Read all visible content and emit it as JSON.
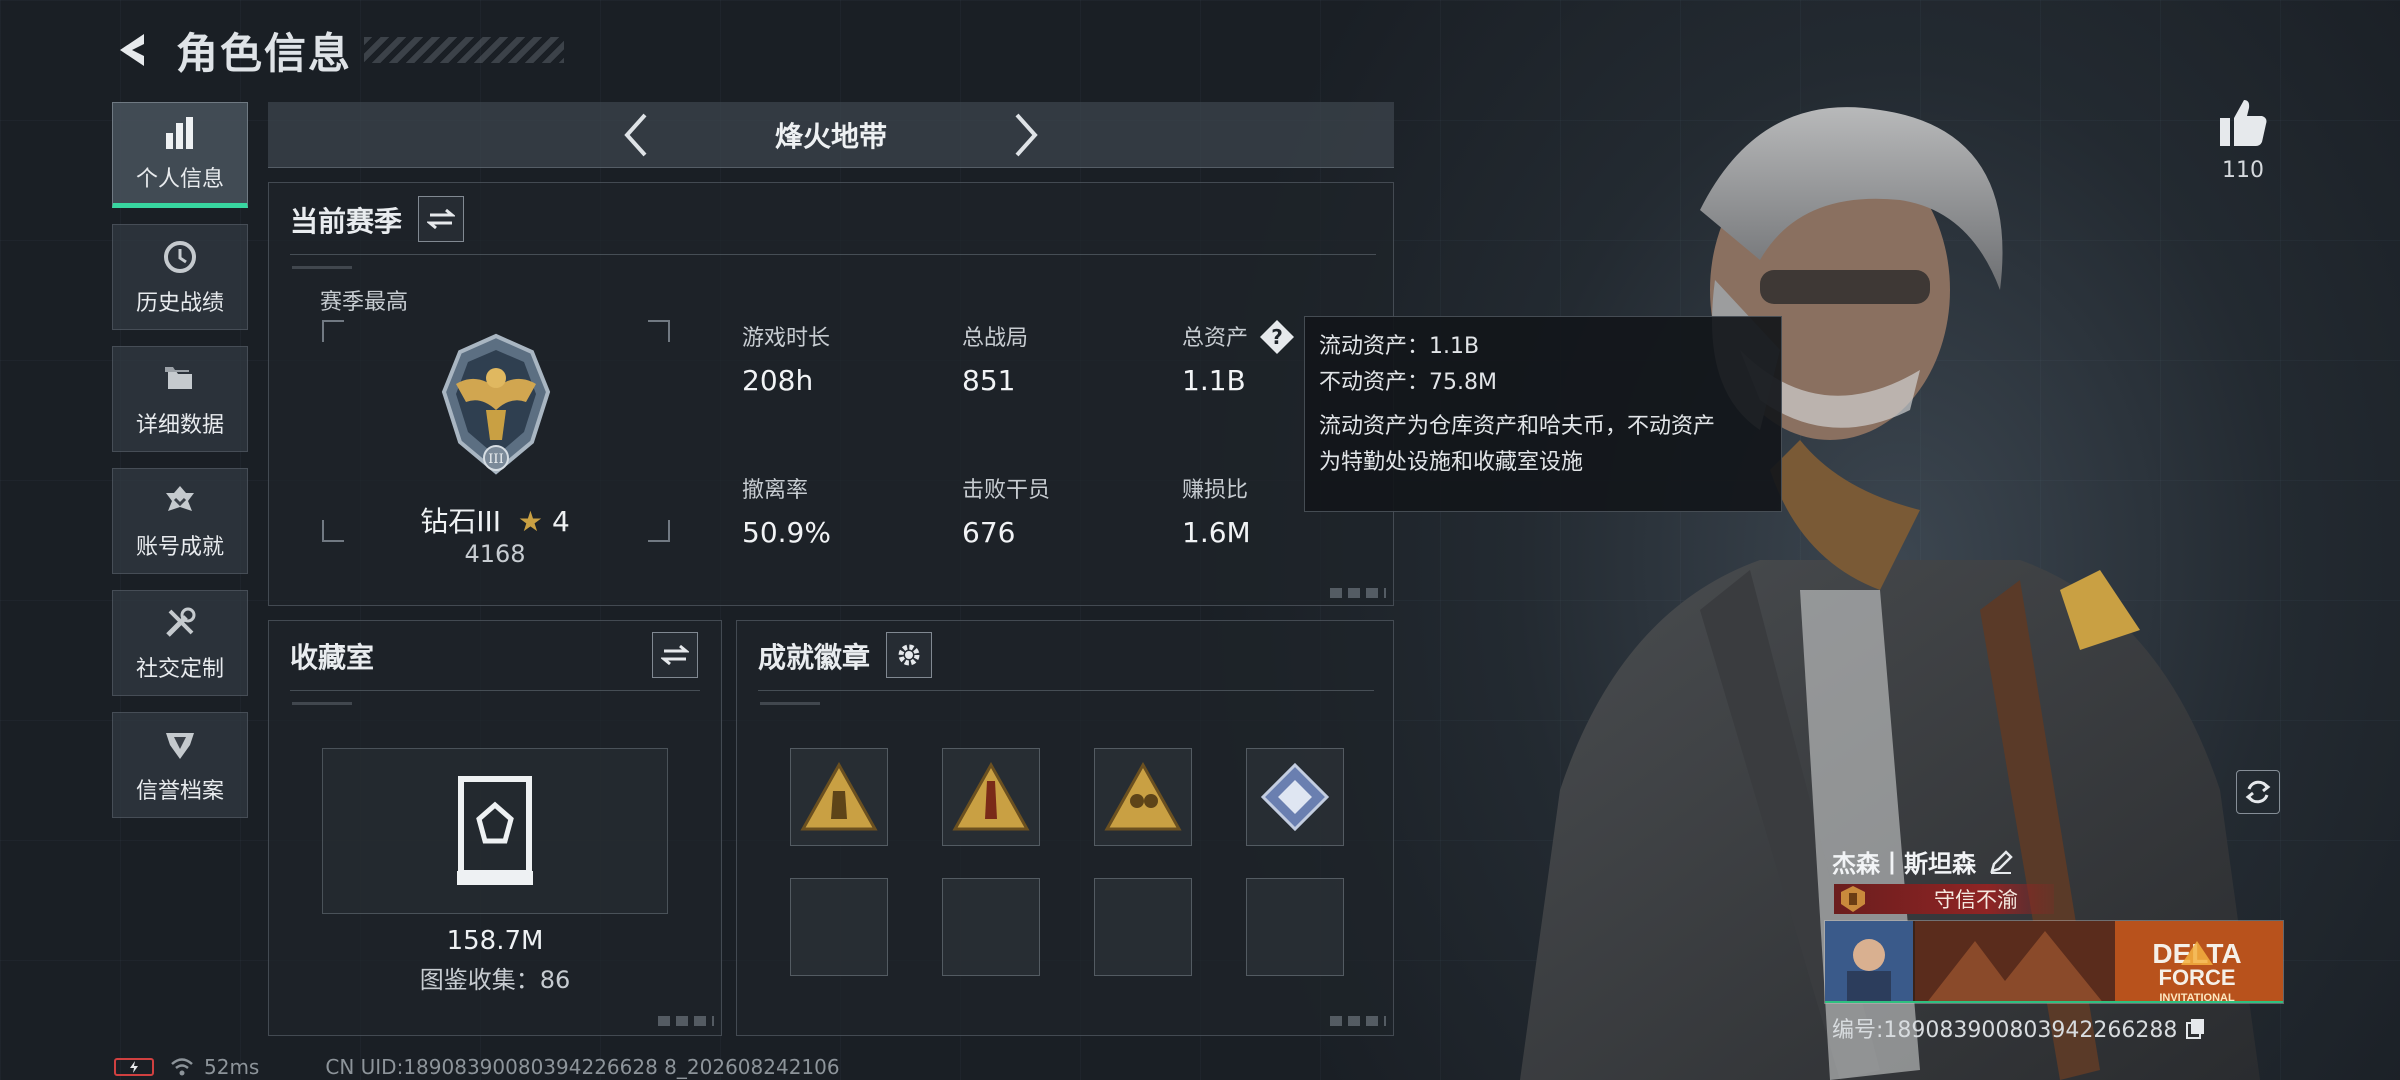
{
  "header": {
    "title": "角色信息"
  },
  "nav": {
    "items": [
      {
        "label": "个人信息",
        "icon": "bar-chart-icon",
        "active": true
      },
      {
        "label": "历史战绩",
        "icon": "history-icon",
        "active": false
      },
      {
        "label": "详细数据",
        "icon": "folder-icon",
        "active": false
      },
      {
        "label": "账号成就",
        "icon": "achievement-icon",
        "active": false
      },
      {
        "label": "社交定制",
        "icon": "tools-icon",
        "active": false
      },
      {
        "label": "信誉档案",
        "icon": "honor-icon",
        "active": false
      }
    ]
  },
  "mode": {
    "title": "烽火地带"
  },
  "season": {
    "title": "当前赛季",
    "best_label": "赛季最高",
    "rank_name": "钻石III",
    "rank_stars": "4",
    "rank_score": "4168",
    "stats": [
      {
        "label": "游戏时长",
        "value": "208h"
      },
      {
        "label": "总战局",
        "value": "851"
      },
      {
        "label": "总资产",
        "value": "1.1B"
      },
      {
        "label": "撤离率",
        "value": "50.9%"
      },
      {
        "label": "击败干员",
        "value": "676"
      },
      {
        "label": "赚损比",
        "value": "1.6M"
      }
    ]
  },
  "tooltip": {
    "liquid": "流动资产：1.1B",
    "fixed": "不动资产：75.8M",
    "desc_line1": "流动资产为仓库资产和哈夫币，不动资产",
    "desc_line2": "为特勤处设施和收藏室设施"
  },
  "collection": {
    "title": "收藏室",
    "value": "158.7M",
    "count": "图鉴收集：86"
  },
  "badges": {
    "title": "成就徽章",
    "filled": 4,
    "total": 8
  },
  "likes": {
    "count": "110"
  },
  "player": {
    "name": "杰森丨斯坦森",
    "title": "守信不渝",
    "card_text_1": "DELTA",
    "card_text_2": "FORCE",
    "card_text_3": "INVITATIONAL",
    "id": "编号:1890839008039422662​88"
  },
  "status": {
    "ping": "52ms",
    "uid": "CN UID:18908390080394226628 8_202608242106"
  },
  "colors": {
    "accent": "#38d6a0",
    "title_red": "#8f2424",
    "gold": "#c9a043"
  }
}
